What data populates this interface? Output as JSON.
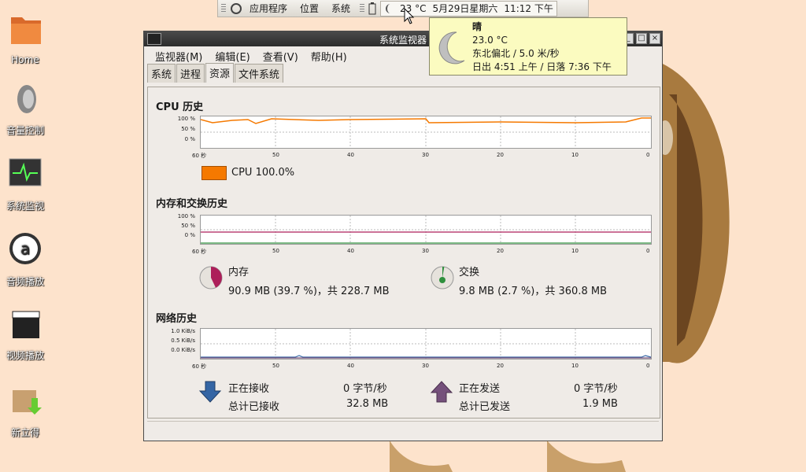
{
  "panel": {
    "menu_apps": "应用程序",
    "menu_places": "位置",
    "menu_system": "系统",
    "temp": "23 °C",
    "date": "5月29日星期六",
    "time": "11:12 下午"
  },
  "weather": {
    "condition": "晴",
    "temp": "23.0 °C",
    "wind": "东北偏北 / 5.0 米/秒",
    "sun": "日出  4:51 上午 / 日落  7:36 下午"
  },
  "desktop": [
    {
      "label": "Home"
    },
    {
      "label": "音量控制"
    },
    {
      "label": "系统监视"
    },
    {
      "label": "音频播放"
    },
    {
      "label": "视频播放"
    },
    {
      "label": "新立得"
    }
  ],
  "window": {
    "title": "系统监视器",
    "menus": [
      "监视器(M)",
      "编辑(E)",
      "查看(V)",
      "帮助(H)"
    ],
    "tabs": [
      "系统",
      "进程",
      "资源",
      "文件系统"
    ],
    "active_tab": "资源"
  },
  "cpu": {
    "title": "CPU 历史",
    "legend": "CPU  100.0%",
    "color": "#f57900",
    "yticks": [
      "100 %",
      "50 %",
      "0 %"
    ],
    "xticks": [
      "60 秒",
      "50",
      "40",
      "30",
      "20",
      "10",
      "0"
    ]
  },
  "mem": {
    "title": "内存和交换历史",
    "yticks": [
      "100 %",
      "50 %",
      "0 %"
    ],
    "xticks": [
      "60 秒",
      "50",
      "40",
      "30",
      "20",
      "10",
      "0"
    ],
    "mem_label": "内存",
    "mem_value": "90.9 MB (39.7 %)，共 228.7 MB",
    "mem_color": "#ad1f5a",
    "swap_label": "交换",
    "swap_value": "9.8 MB (2.7 %)，共 360.8 MB",
    "swap_color": "#2e8f3c"
  },
  "net": {
    "title": "网络历史",
    "yticks": [
      "1.0 KiB/s",
      "0.5 KiB/s",
      "0.0 KiB/s"
    ],
    "xticks": [
      "60 秒",
      "50",
      "40",
      "30",
      "20",
      "10",
      "0"
    ],
    "recv_label": "正在接收",
    "recv_rate": "0 字节/秒",
    "recv_total_label": "总计已接收",
    "recv_total": "32.8 MB",
    "send_label": "正在发送",
    "send_rate": "0 字节/秒",
    "send_total_label": "总计已发送",
    "send_total": "1.9 MB",
    "recv_color": "#3465a4",
    "send_color": "#75507b"
  }
}
